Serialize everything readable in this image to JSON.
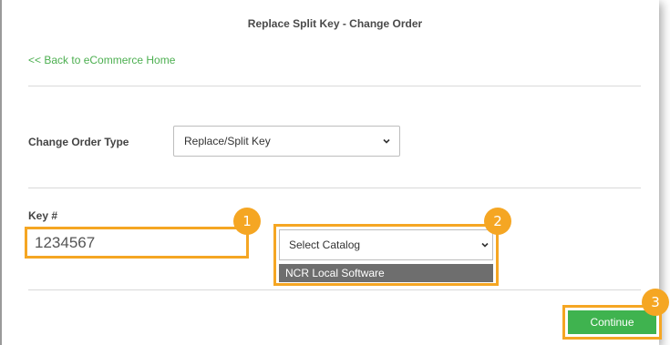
{
  "page": {
    "title": "Replace Split Key - Change Order",
    "back_link": "<< Back to eCommerce Home"
  },
  "change_order": {
    "label": "Change Order Type",
    "selected": "Replace/Split Key"
  },
  "key": {
    "label": "Key #",
    "value": "1234567"
  },
  "catalog": {
    "selected": "Select Catalog",
    "options": [
      "NCR Local Software"
    ]
  },
  "actions": {
    "continue_label": "Continue"
  },
  "callouts": [
    "1",
    "2",
    "3"
  ],
  "colors": {
    "accent_orange": "#f5a623",
    "link_green": "#4caf50",
    "button_green": "#3fb34f",
    "option_highlight": "#6e6e6e"
  }
}
